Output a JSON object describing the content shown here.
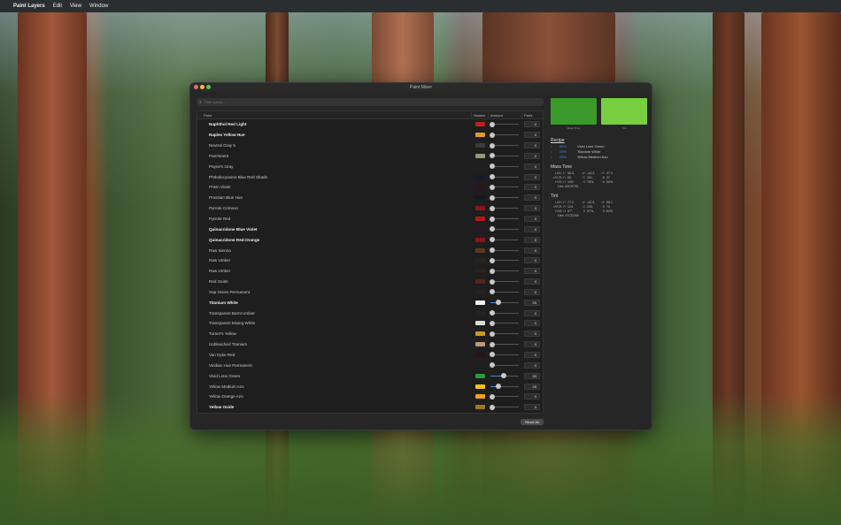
{
  "menubar": {
    "apple": "",
    "app": "Paint Layers",
    "items": [
      "Edit",
      "View",
      "Window"
    ]
  },
  "window": {
    "title": "Paint Mixer",
    "filter_placeholder": "Filter paints...",
    "headers": {
      "paint": "Paint",
      "swatch": "Swatch",
      "amount": "Amount",
      "parts": "Parts"
    },
    "reset_label": "Reset All"
  },
  "paints": [
    {
      "name": "Naphthol Red Light",
      "bold": true,
      "color": "#c0201e",
      "parts": "0",
      "level": 0
    },
    {
      "name": "Naples Yellow Hue",
      "bold": true,
      "color": "#e29a2a",
      "parts": "0",
      "level": 0
    },
    {
      "name": "Neutral Gray 5",
      "bold": false,
      "color": "#3a3a3a",
      "parts": "0",
      "level": 0
    },
    {
      "name": "Parchment",
      "bold": false,
      "color": "#9a9870",
      "parts": "0",
      "level": 0
    },
    {
      "name": "Payne's Gray",
      "bold": false,
      "color": "#1e1e22",
      "parts": "0",
      "level": 0
    },
    {
      "name": "Phthalocyanine Blue Red Shade",
      "bold": false,
      "color": "#18182a",
      "parts": "0",
      "level": 0
    },
    {
      "name": "Prism Violet",
      "bold": false,
      "color": "#2a1420",
      "parts": "0",
      "level": 0
    },
    {
      "name": "Prussian Blue Hue",
      "bold": false,
      "color": "#15181c",
      "parts": "0",
      "level": 0
    },
    {
      "name": "Pyrrole Crimson",
      "bold": false,
      "color": "#8a1420",
      "parts": "0",
      "level": 0
    },
    {
      "name": "Pyrrole Red",
      "bold": false,
      "color": "#b81618",
      "parts": "0",
      "level": 0
    },
    {
      "name": "Quinacridone Blue Violet",
      "bold": true,
      "color": "#2a1428",
      "parts": "0",
      "level": 0
    },
    {
      "name": "Quinacridone Red-Orange",
      "bold": true,
      "color": "#8a1418",
      "parts": "0",
      "level": 0
    },
    {
      "name": "Raw Sienna",
      "bold": false,
      "color": "#5a3a22",
      "parts": "0",
      "level": 0
    },
    {
      "name": "Raw Umber",
      "bold": false,
      "color": "#2a2420",
      "parts": "0",
      "level": 0
    },
    {
      "name": "Raw Umber",
      "bold": false,
      "color": "#2a2420",
      "parts": "0",
      "level": 0
    },
    {
      "name": "Red Oxide",
      "bold": false,
      "color": "#5a2418",
      "parts": "0",
      "level": 0
    },
    {
      "name": "Sap Green Permanent",
      "bold": false,
      "color": "#222420",
      "parts": "0",
      "level": 0
    },
    {
      "name": "Titanium White",
      "bold": true,
      "color": "#f2f2f2",
      "parts": "25",
      "level": 0.25
    },
    {
      "name": "Transparent Burnt Umber",
      "bold": false,
      "color": "#2a2220",
      "parts": "0",
      "level": 0
    },
    {
      "name": "Transparent Mixing White",
      "bold": false,
      "color": "#dcdcdc",
      "parts": "0",
      "level": 0
    },
    {
      "name": "Turner's Yellow",
      "bold": false,
      "color": "#c89a1a",
      "parts": "0",
      "level": 0
    },
    {
      "name": "Unbleached Titanium",
      "bold": false,
      "color": "#b89a78",
      "parts": "0",
      "level": 0
    },
    {
      "name": "Van Dyke Red",
      "bold": false,
      "color": "#2a1414",
      "parts": "0",
      "level": 0
    },
    {
      "name": "Viridian Hue Permanent",
      "bold": false,
      "color": "#1a2220",
      "parts": "0",
      "level": 0
    },
    {
      "name": "Vivid Lime Green",
      "bold": false,
      "color": "#2a9a3a",
      "parts": "50",
      "level": 0.5
    },
    {
      "name": "Yellow Medium Azo",
      "bold": false,
      "color": "#f2c21a",
      "parts": "25",
      "level": 0.25
    },
    {
      "name": "Yellow Orange Azo",
      "bold": false,
      "color": "#f2a21a",
      "parts": "0",
      "level": 0
    },
    {
      "name": "Yellow Oxide",
      "bold": true,
      "color": "#a0781a",
      "parts": "0",
      "level": 0
    }
  ],
  "preview": {
    "mass_tone_color": "#3a9a2a",
    "tint_color": "#78d040",
    "mass_tone_label": "Mass Tone",
    "tint_label": "Tint"
  },
  "recipe": {
    "title": "Recipe",
    "items": [
      {
        "dot": "•",
        "pct": "50%",
        "name": "Vivid Lime Green"
      },
      {
        "dot": "•",
        "pct": "25%",
        "name": "Titanium White"
      },
      {
        "dot": "•",
        "pct": "25%",
        "name": "Yellow Medium Azo"
      }
    ]
  },
  "mass_tone": {
    "title": "Mass Tone",
    "lines": [
      {
        "k": "LAB: L*",
        "v1": "55.3,",
        "k2": "a*",
        "v2": "-44.2,",
        "k3": "b*",
        "v3": "47.1"
      },
      {
        "k": "sRGB: R",
        "v1": "60,",
        "k2": "G",
        "v2": "151,",
        "k3": "B",
        "v3": "37"
      },
      {
        "k": "HSB: H",
        "v1": "109°,",
        "k2": "S",
        "v2": "76%,",
        "k3": "B",
        "v3": "59%"
      }
    ],
    "hex": "Hex: #3C9725"
  },
  "tint": {
    "title": "Tint",
    "lines": [
      {
        "k": "LAB: L*",
        "v1": "77.2,",
        "k2": "a*",
        "v2": "-42.5,",
        "k3": "b*",
        "v3": "58.1"
      },
      {
        "k": "sRGB: R",
        "v1": "124,",
        "k2": "G",
        "v2": "210,",
        "k3": "B",
        "v3": "70"
      },
      {
        "k": "HSB: H",
        "v1": "97°,",
        "k2": "S",
        "v2": "67%,",
        "k3": "B",
        "v3": "82%"
      }
    ],
    "hex": "Hex: #7CD246"
  }
}
